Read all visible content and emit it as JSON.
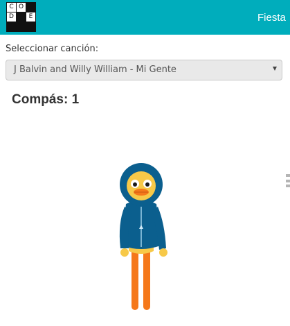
{
  "header": {
    "logo_letters": [
      "C",
      "O",
      "",
      "D",
      "",
      "E"
    ],
    "title": "Fiesta"
  },
  "song": {
    "label": "Seleccionar canción:",
    "selected": "J Balvin and Willy William - Mi Gente"
  },
  "measure": {
    "text": "Compás: 1"
  },
  "icons": {
    "dropdown": "chevron-down-icon",
    "handle": "drag-handle-icon",
    "character": "duck-dancer"
  },
  "colors": {
    "header_bg": "#00adbc",
    "hood": "#0b5f8e",
    "legs": "#f5781a"
  }
}
